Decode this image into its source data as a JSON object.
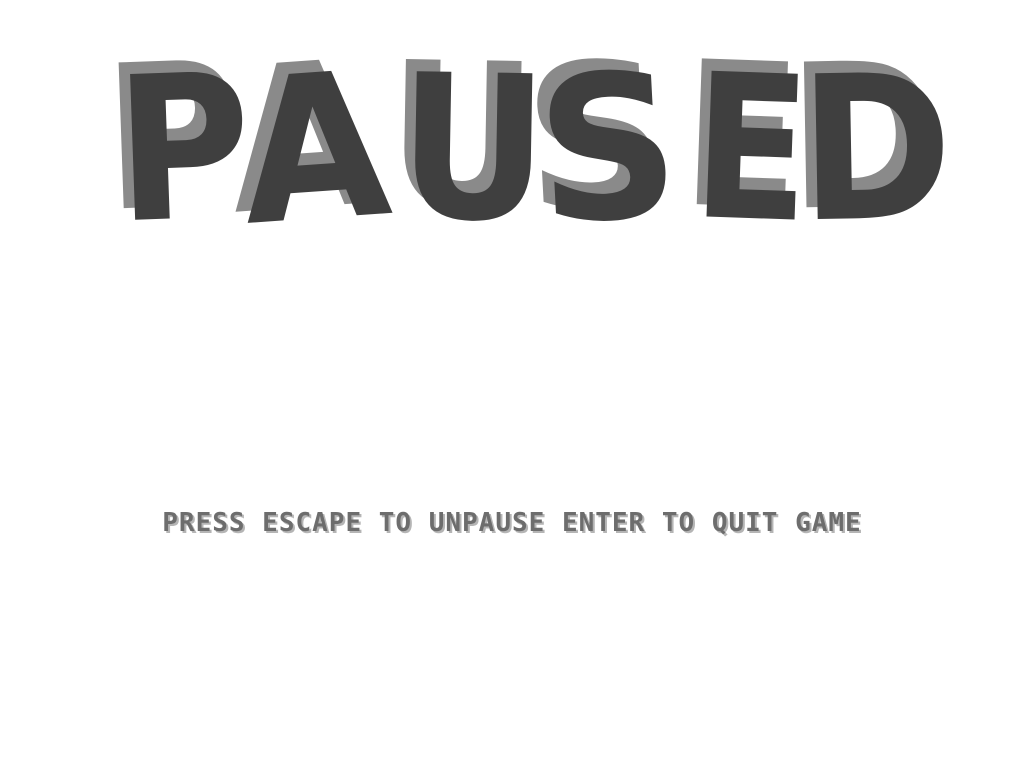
{
  "pause_screen": {
    "title": "PAUSED",
    "title_letters": [
      "P",
      "A",
      "U",
      "S",
      "E",
      "D"
    ],
    "prompt": "PRESS ESCAPE TO UNPAUSE ENTER TO QUIT GAME"
  },
  "colors": {
    "background": "#ffffff",
    "title_face": "#3f3f3f",
    "title_shadow": "#8a8a8a",
    "prompt_face": "#6d6d6d",
    "prompt_shadow": "#b5b5b5"
  }
}
